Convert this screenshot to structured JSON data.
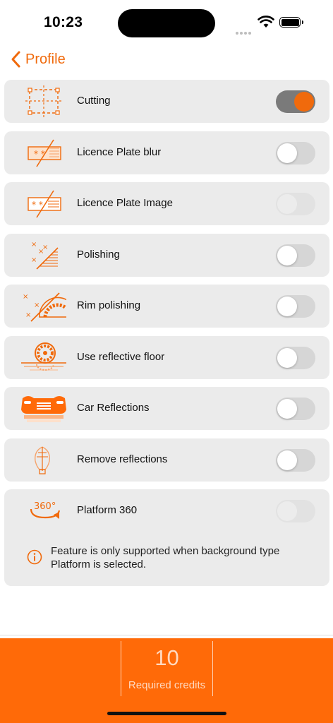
{
  "status_bar": {
    "time": "10:23"
  },
  "nav": {
    "back_label": "Profile"
  },
  "options": [
    {
      "label": "Cutting",
      "icon": "cutting-icon",
      "state": "on"
    },
    {
      "label": "Licence Plate blur",
      "icon": "plate-blur-icon",
      "state": "off"
    },
    {
      "label": "Licence Plate Image",
      "icon": "plate-image-icon",
      "state": "disabled"
    },
    {
      "label": "Polishing",
      "icon": "polishing-icon",
      "state": "off"
    },
    {
      "label": "Rim polishing",
      "icon": "rim-polishing-icon",
      "state": "off"
    },
    {
      "label": "Use reflective floor",
      "icon": "reflective-floor-icon",
      "state": "off"
    },
    {
      "label": "Car Reflections",
      "icon": "car-reflections-icon",
      "state": "off"
    },
    {
      "label": "Remove reflections",
      "icon": "remove-reflections-icon",
      "state": "off"
    },
    {
      "label": "Platform 360",
      "icon": "platform-360-icon",
      "state": "disabled",
      "note": "Feature is only supported when background type Platform is selected."
    }
  ],
  "footer": {
    "credits_value": "10",
    "credits_label": "Required credits"
  },
  "colors": {
    "accent": "#f06a0c",
    "footer_bg": "#ff6a08",
    "row_bg": "#ebebeb"
  }
}
